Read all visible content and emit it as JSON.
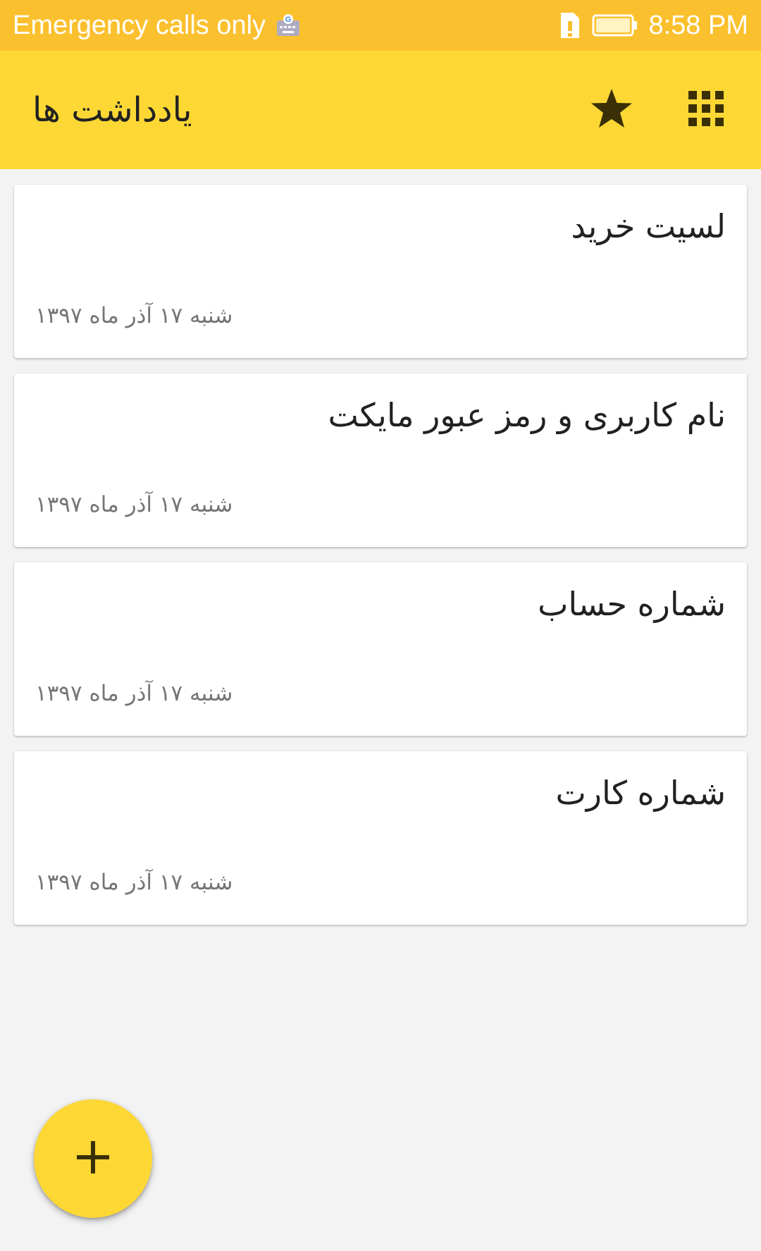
{
  "status_bar": {
    "carrier_text": "Emergency calls only",
    "time": "8:58 PM",
    "icons": [
      "keyboard-google-icon",
      "sim-alert-icon",
      "battery-icon"
    ]
  },
  "app_bar": {
    "title": "یادداشت ها",
    "icons": [
      "star-icon",
      "grid-menu-icon"
    ]
  },
  "notes": [
    {
      "title": "لسیت خرید",
      "date": "شنبه ۱۷ آذر ماه ۱۳۹۷"
    },
    {
      "title": "نام کاربری و رمز عبور مایکت",
      "date": "شنبه ۱۷ آذر ماه ۱۳۹۷"
    },
    {
      "title": "شماره حساب",
      "date": "شنبه ۱۷ آذر ماه ۱۳۹۷"
    },
    {
      "title": "شماره کارت",
      "date": "شنبه ۱۷ آذر ماه ۱۳۹۷"
    }
  ],
  "fab": {
    "icon": "plus-icon"
  },
  "colors": {
    "status_bar": "#fbc02d",
    "app_bar": "#fdd835",
    "fab": "#fdd835",
    "background": "#f3f3f3",
    "icon_dark": "#3a2f05"
  }
}
